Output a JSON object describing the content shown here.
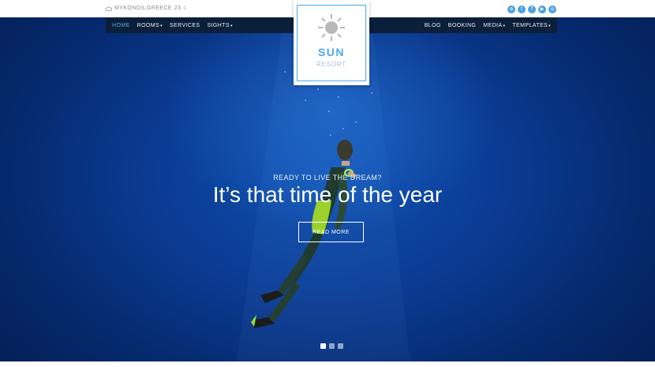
{
  "topbar": {
    "weather": {
      "icon": "cloud-icon",
      "location": "MYKONOS,GREECE",
      "temperature": "23",
      "unit": "C"
    },
    "social": [
      {
        "icon": "globe-icon",
        "glyph": "⊕"
      },
      {
        "icon": "twitter-icon",
        "glyph": "t"
      },
      {
        "icon": "facebook-icon",
        "glyph": "f"
      },
      {
        "icon": "youtube-icon",
        "glyph": "▶"
      },
      {
        "icon": "instagram-icon",
        "glyph": "◎"
      }
    ]
  },
  "nav": {
    "left": [
      {
        "label": "HOME",
        "active": true
      },
      {
        "label": "ROOMS",
        "dropdown": true
      },
      {
        "label": "SERVICES"
      },
      {
        "label": "SIGHTS",
        "dropdown": true
      }
    ],
    "right": [
      {
        "label": "BLOG"
      },
      {
        "label": "BOOKING"
      },
      {
        "label": "MEDIA",
        "dropdown": true
      },
      {
        "label": "TEMPLATES",
        "dropdown": true
      }
    ],
    "caret": "▾"
  },
  "logo": {
    "icon": "sun-icon",
    "name": "SUN",
    "tagline": "RESORT"
  },
  "hero": {
    "kicker": "READY TO LIVE THE DREAM?",
    "headline": "It’s that time of the year",
    "button": "READ MORE",
    "slides": 3,
    "active_slide": 1
  },
  "colors": {
    "accent": "#4ea8ee",
    "navbar": "#0b1f3a",
    "hero": "#0a3a91"
  }
}
